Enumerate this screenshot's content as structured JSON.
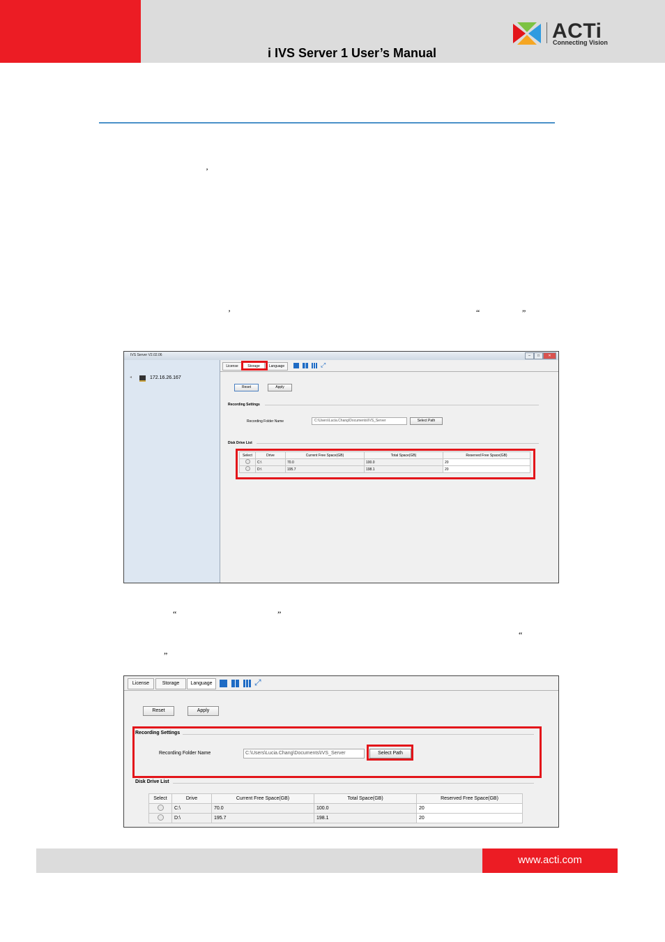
{
  "header": {
    "title": "i IVS Server 1 User’s Manual",
    "logo_wordmark": "ACTi",
    "logo_tagline": "Connecting Vision",
    "logo_colors": [
      "#e3151a",
      "#2f9be0",
      "#7cc242",
      "#f5a623"
    ]
  },
  "body_marks": {
    "apostrophe_1": "’",
    "apostrophe_2": "’",
    "open_quote_1": "“",
    "close_quote_1": "”",
    "open_quote_2": "“",
    "close_quote_2": "”",
    "open_quote_3": "“",
    "close_quote_3": "”"
  },
  "screenshot1": {
    "window_title": "IVS Server V2.02.06",
    "window_buttons": [
      "–",
      "□",
      "✕"
    ],
    "tree_host": "172.16.26.167",
    "tabs": [
      "License",
      "Storage",
      "Language"
    ],
    "reset_label": "Reset",
    "apply_label": "Apply",
    "recording_settings_label": "Recording Settings",
    "folder_label": "Recording Folder Name",
    "folder_value": "C:\\Users\\Lucia.Chang\\Documents\\IVS_Server",
    "select_path_label": "Select Path",
    "disk_list_label": "Disk Drive List",
    "table_headers": [
      "Select",
      "Drive",
      "Current Free Space(GB)",
      "Total Space(GB)",
      "Reserved Free Space(GB)"
    ],
    "rows": [
      {
        "drive": "C:\\",
        "free": "70.0",
        "total": "100.0",
        "reserved": "20"
      },
      {
        "drive": "D:\\",
        "free": "195.7",
        "total": "198.1",
        "reserved": "20"
      }
    ]
  },
  "screenshot2": {
    "tabs": [
      "License",
      "Storage",
      "Language"
    ],
    "reset_label": "Reset",
    "apply_label": "Apply",
    "recording_settings_label": "Recording Settings",
    "folder_label": "Recording Folder Name",
    "folder_value": "C:\\Users\\Lucia.Chang\\Documents\\IVS_Server",
    "select_path_label": "Select Path",
    "disk_list_label": "Disk Drive List",
    "table_headers": [
      "Select",
      "Drive",
      "Current Free Space(GB)",
      "Total Space(GB)",
      "Reserved Free Space(GB)"
    ],
    "rows": [
      {
        "drive": "C:\\",
        "free": "70.0",
        "total": "100.0",
        "reserved": "20"
      },
      {
        "drive": "D:\\",
        "free": "195.7",
        "total": "198.1",
        "reserved": "20"
      }
    ]
  },
  "footer": {
    "url": "www.acti.com"
  },
  "colors": {
    "brand_red": "#ec1c24",
    "header_gray": "#dcdcdc",
    "rule_blue": "#4a90c8",
    "highlight_red": "#e3151a"
  }
}
